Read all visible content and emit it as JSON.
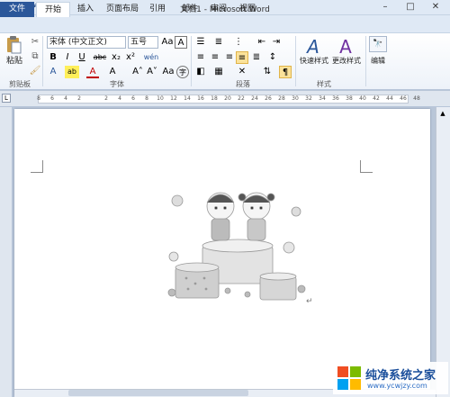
{
  "window": {
    "title": "文档1 - Microsoft Word",
    "minimize": "–",
    "restore": "□",
    "close": "✕"
  },
  "quick_access": [
    "W",
    "💾",
    "↶",
    "↷",
    "▾"
  ],
  "tabs": [
    {
      "label": "文件"
    },
    {
      "label": "开始"
    },
    {
      "label": "插入"
    },
    {
      "label": "页面布局"
    },
    {
      "label": "引用"
    },
    {
      "label": "邮件"
    },
    {
      "label": "审阅"
    },
    {
      "label": "视图"
    }
  ],
  "ribbon": {
    "clipboard": {
      "paste_label": "粘贴",
      "group_label": "剪贴板"
    },
    "font": {
      "font_name": "宋体 (中文正文)",
      "font_size": "五号",
      "group_label": "字体",
      "btn_bold": "B",
      "btn_italic": "I",
      "btn_underline": "U",
      "btn_strike": "abc",
      "btn_sub": "x₂",
      "btn_sup": "x²",
      "btn_grow": "A˄",
      "btn_shrink": "A˅",
      "btn_aa": "Aa",
      "btn_clear": "A",
      "btn_wen": "wén",
      "btn_char_border": "A",
      "btn_highlight": "ab",
      "btn_fontcolor": "A",
      "btn_char_shade": "A",
      "btn_enclose": "字"
    },
    "paragraph": {
      "group_label": "段落"
    },
    "styles": {
      "quick_styles": "快速样式",
      "change_styles": "更改样式",
      "group_label": "样式"
    },
    "editing": {
      "label": "编辑"
    }
  },
  "ruler": {
    "ticks": [
      "8",
      "6",
      "4",
      "2",
      "",
      "2",
      "4",
      "6",
      "8",
      "10",
      "12",
      "14",
      "16",
      "18",
      "20",
      "22",
      "24",
      "26",
      "28",
      "30",
      "32",
      "34",
      "36",
      "38",
      "40",
      "42",
      "44",
      "46",
      "48"
    ]
  },
  "document": {
    "paragraph_mark": "↵"
  },
  "watermark": {
    "brand": "纯净系统之家",
    "url": "www.ycwjzy.com"
  },
  "colors": {
    "accent": "#2b579a",
    "ribbon_bg": "#ffffff",
    "canvas": "#b9c6d8"
  }
}
